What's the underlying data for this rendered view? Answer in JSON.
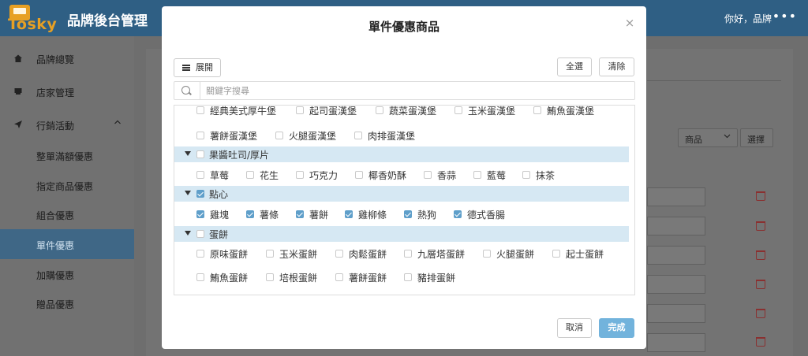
{
  "app": {
    "logo_text": "Tosky",
    "title": "品牌後台管理",
    "greeting": "你好，品牌",
    "more": "•••"
  },
  "sidebar": {
    "items": [
      {
        "label": "品牌總覽",
        "icon": "home-icon"
      },
      {
        "label": "店家管理",
        "icon": "store-icon"
      },
      {
        "label": "行銷活動",
        "icon": "send-icon",
        "expanded": true
      },
      {
        "label": "整單滿額優惠"
      },
      {
        "label": "指定商品優惠"
      },
      {
        "label": "組合優惠"
      },
      {
        "label": "單件優惠",
        "active": true
      },
      {
        "label": "加購優惠"
      },
      {
        "label": "贈品優惠"
      }
    ]
  },
  "background": {
    "select_value": "商品",
    "select_button": "選擇"
  },
  "modal": {
    "title": "單件優惠商品",
    "close": "×",
    "expand_label": "展開",
    "select_all_label": "全選",
    "clear_label": "清除",
    "search_placeholder": "關鍵字搜尋",
    "partial_row": [
      "經典美式厚牛堡",
      "起司蛋漢堡",
      "蔬菜蛋漢堡",
      "玉米蛋漢堡",
      "鮪魚蛋漢堡"
    ],
    "burger_row": [
      "薯餅蛋漢堡",
      "火腿蛋漢堡",
      "肉排蛋漢堡"
    ],
    "categories": [
      {
        "name": "果醬吐司/厚片",
        "checked": false,
        "items": [
          "草莓",
          "花生",
          "巧克力",
          "椰香奶酥",
          "香蒜",
          "藍莓",
          "抹茶"
        ],
        "items_checked": false
      },
      {
        "name": "點心",
        "checked": true,
        "items": [
          "雞塊",
          "薯條",
          "薯餅",
          "雞柳條",
          "熱狗",
          "德式香腸"
        ],
        "items_checked": true
      },
      {
        "name": "蛋餅",
        "checked": false,
        "items": [
          "原味蛋餅",
          "玉米蛋餅",
          "肉鬆蛋餅",
          "九層塔蛋餅",
          "火腿蛋餅",
          "起士蛋餅"
        ],
        "items2": [
          "鮪魚蛋餅",
          "培根蛋餅",
          "薯餅蛋餅",
          "豬排蛋餅"
        ],
        "items_checked": false
      }
    ],
    "cancel_label": "取消",
    "done_label": "完成"
  }
}
